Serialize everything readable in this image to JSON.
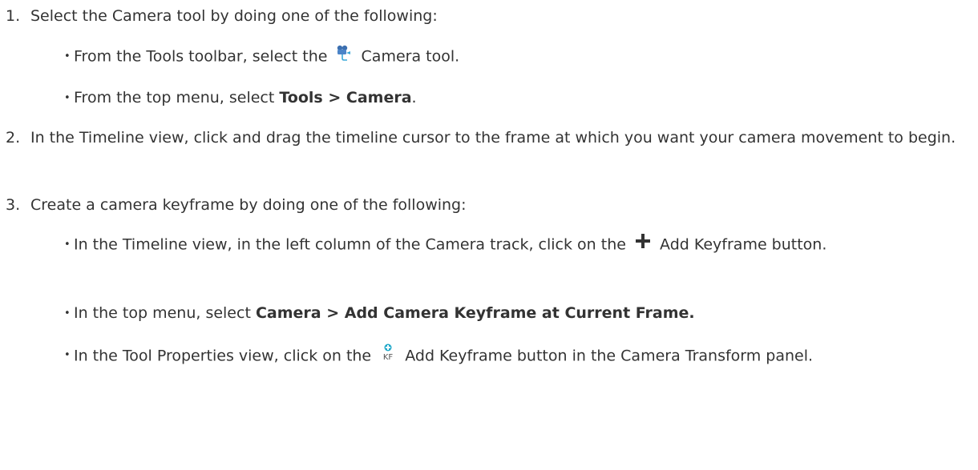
{
  "steps": [
    {
      "number": "1.",
      "text": "Select the Camera tool by doing one of the following:",
      "bullets": [
        {
          "before": "From the Tools toolbar, select the",
          "icon": "camera-tool-icon",
          "after": "Camera tool."
        },
        {
          "before": "From the top menu, select",
          "bold": "Tools > Camera",
          "after": "."
        }
      ]
    },
    {
      "number": "2.",
      "text": "In the Timeline view, click and drag the timeline cursor to the frame at which you want your camera movement to begin."
    },
    {
      "number": "3.",
      "text": "Create a camera keyframe by doing one of the following:",
      "bullets": [
        {
          "before": "In the Timeline view, in the left column of the Camera track, click on the",
          "icon": "add-plus-icon",
          "after": "Add Keyframe button."
        },
        {
          "before": "In the top menu, select",
          "bold": "Camera > Add Camera Keyframe at Current Frame."
        },
        {
          "before": "In the Tool Properties view, click on the",
          "icon": "add-keyframe-kf-icon",
          "after": "Add Keyframe button in the Camera Transform panel."
        }
      ]
    }
  ],
  "bullet_glyph": "•"
}
